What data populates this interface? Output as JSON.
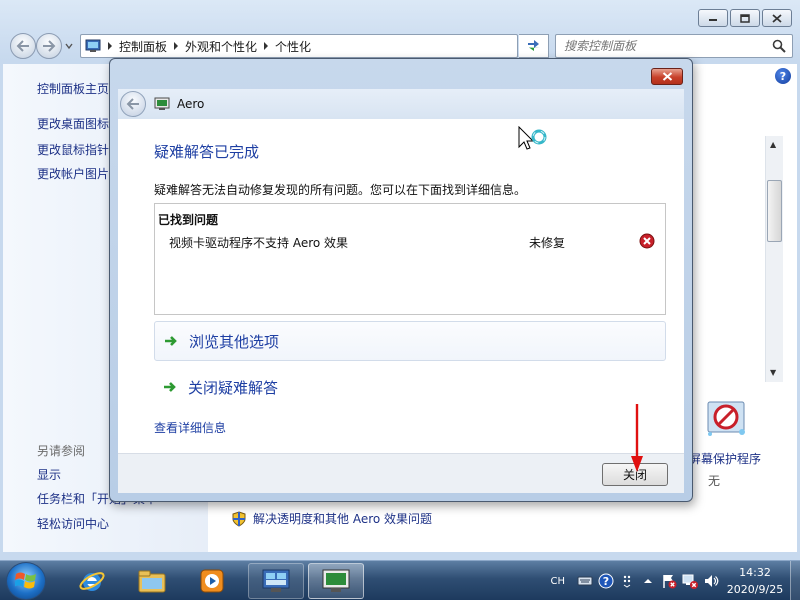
{
  "explorer": {
    "breadcrumbs": [
      "控制面板",
      "外观和个性化",
      "个性化"
    ],
    "search_placeholder": "搜索控制面板",
    "left_pane": {
      "links": [
        "控制面板主页",
        "更改桌面图标",
        "更改鼠标指针",
        "更改帐户图片"
      ],
      "see_also_heading": "另请参阅",
      "see_also": [
        "显示",
        "任务栏和「开始」菜单",
        "轻松访问中心"
      ]
    },
    "screensaver": {
      "label": "屏幕保护程序",
      "value": "无"
    },
    "aero_troubleshoot_link": "解决透明度和其他 Aero 效果问题"
  },
  "dialog": {
    "title": "Aero",
    "heading": "疑难解答已完成",
    "description": "疑难解答无法自动修复发现的所有问题。您可以在下面找到详细信息。",
    "issues_header": "已找到问题",
    "issues": [
      {
        "name": "视频卡驱动程序不支持 Aero 效果",
        "status": "未修复",
        "status_icon": "error-icon"
      }
    ],
    "options": [
      "浏览其他选项",
      "关闭疑难解答"
    ],
    "details_link": "查看详细信息",
    "close_button": "关闭"
  },
  "taskbar": {
    "language": "CH",
    "clock_time": "14:32",
    "clock_date": "2020/9/25",
    "pinned": [
      "start-orb",
      "internet-explorer-icon",
      "file-explorer-icon",
      "media-player-icon",
      "control-panel-icon",
      "aero-troubleshooter-icon"
    ]
  },
  "colors": {
    "link_blue": "#1e3287",
    "heading_blue": "#1e3fa3",
    "error_red": "#c8202a",
    "annotation_red": "#e01010",
    "option_green": "#2d9a32"
  }
}
